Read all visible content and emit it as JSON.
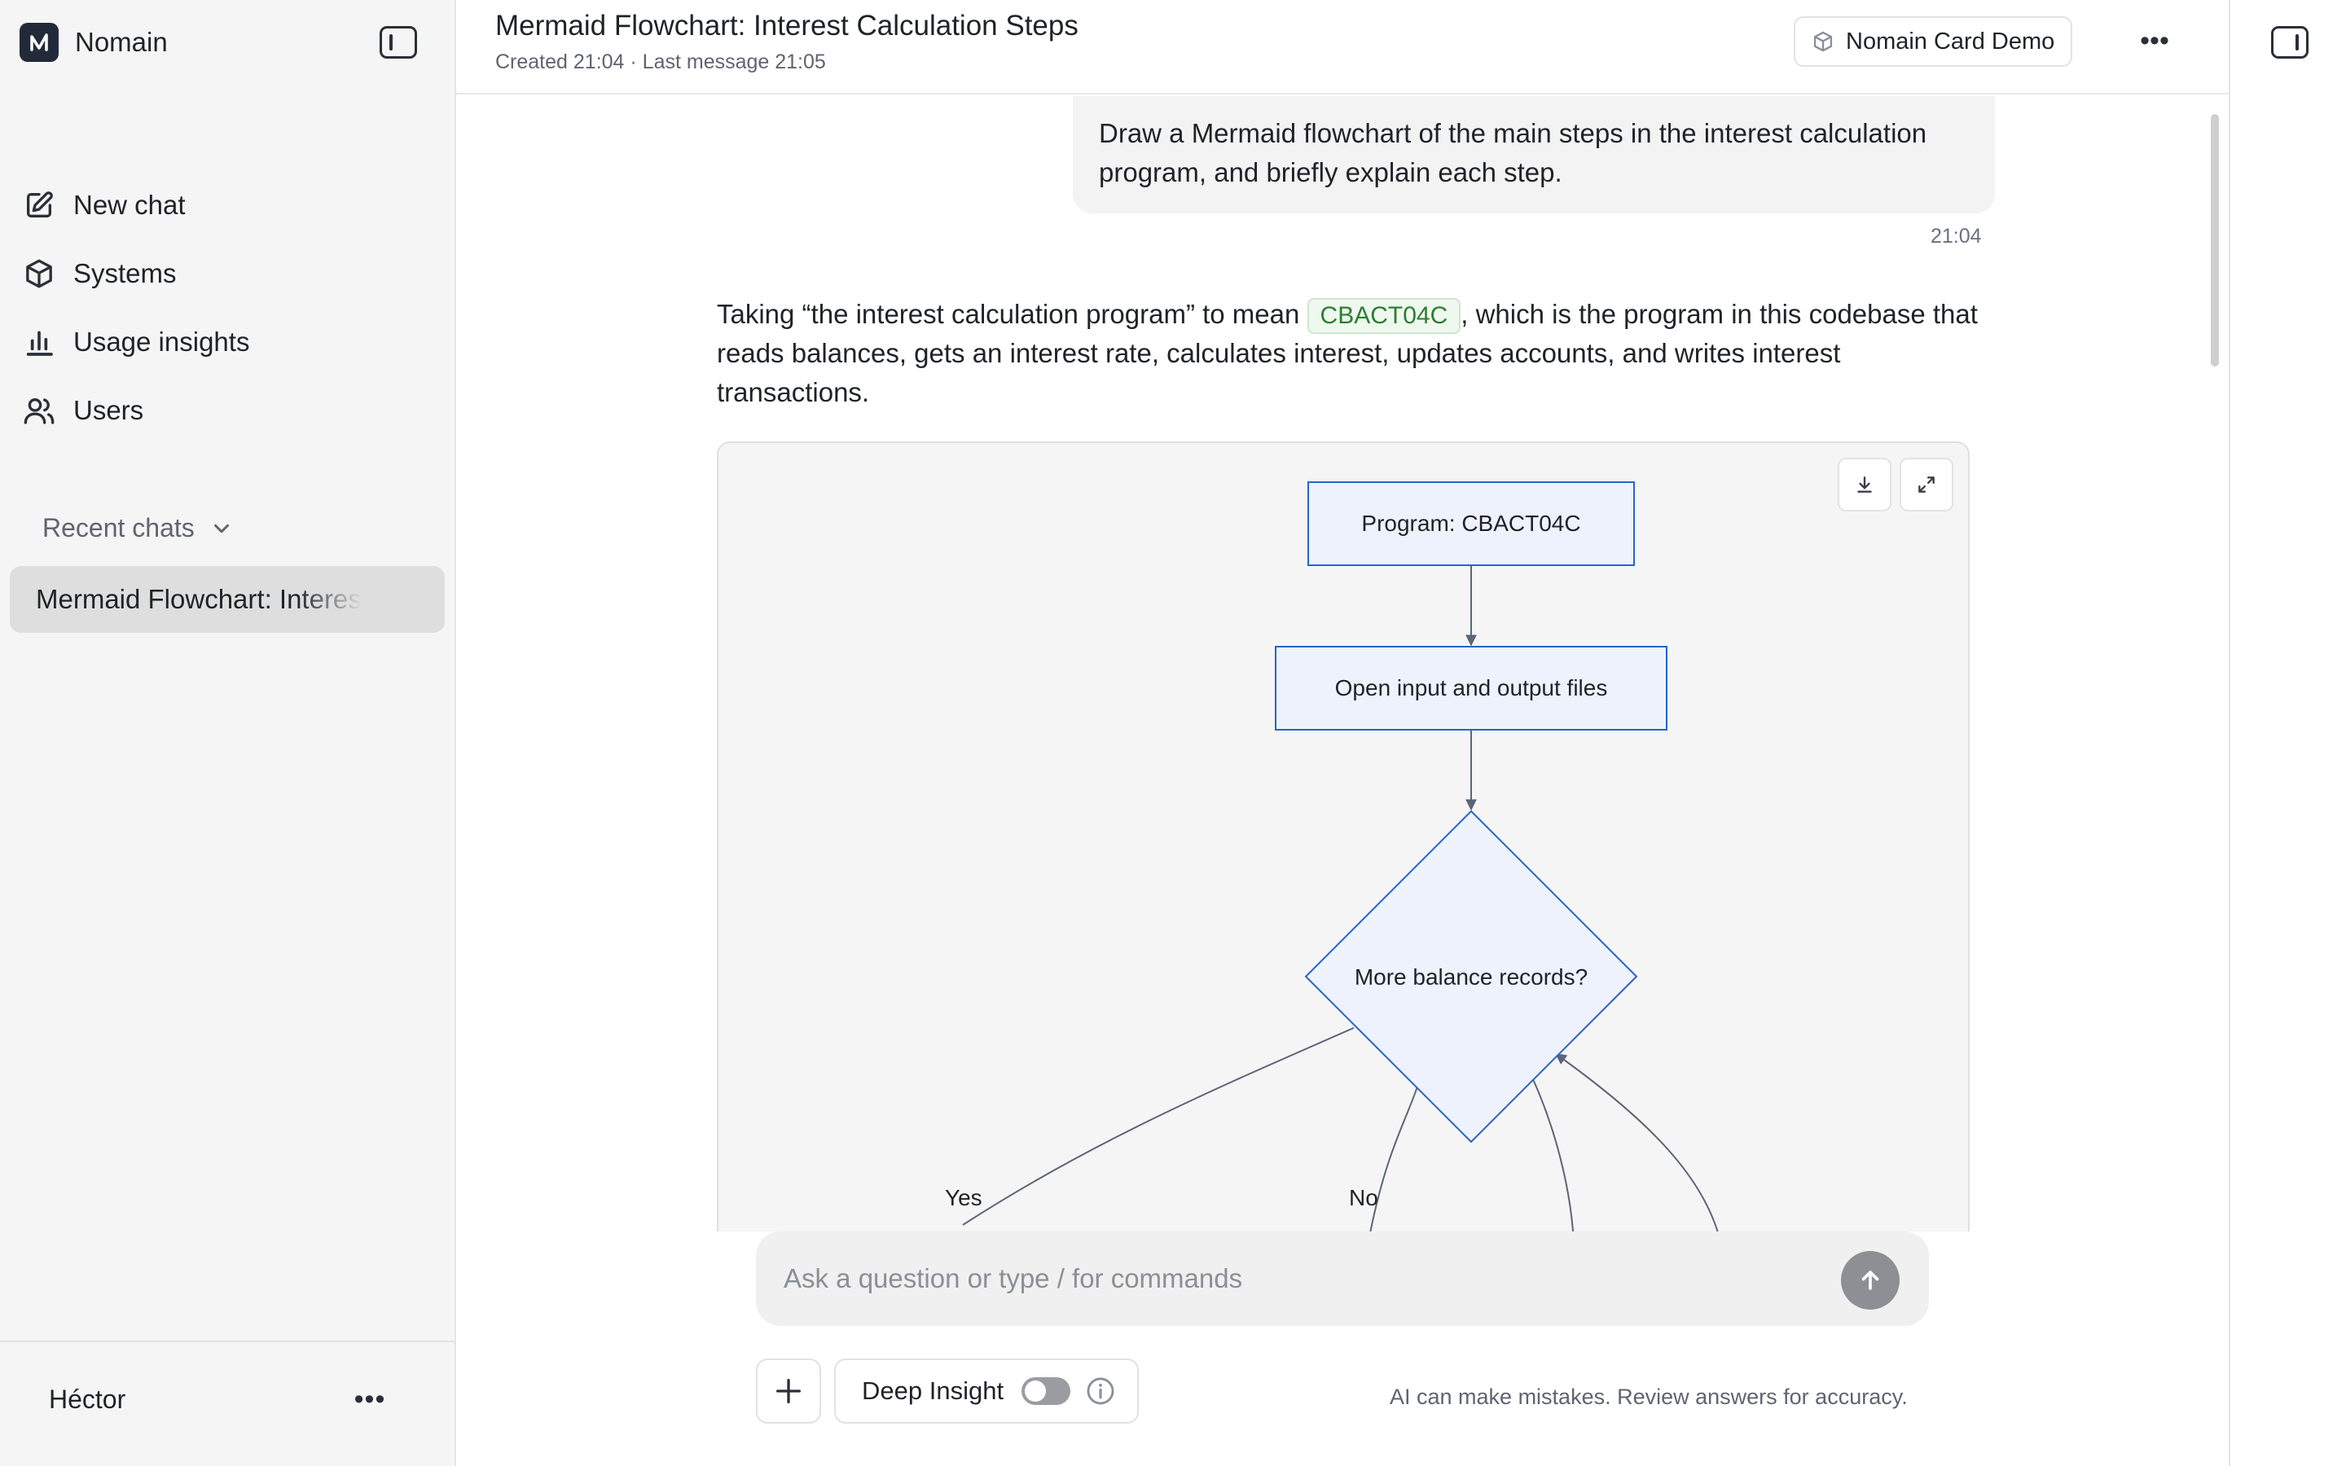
{
  "app": {
    "name": "Nomain"
  },
  "sidebar": {
    "nav": [
      {
        "id": "new-chat",
        "label": "New chat",
        "icon": "edit-icon"
      },
      {
        "id": "systems",
        "label": "Systems",
        "icon": "cube-icon"
      },
      {
        "id": "usage-insights",
        "label": "Usage insights",
        "icon": "bar-chart-icon"
      },
      {
        "id": "users",
        "label": "Users",
        "icon": "users-icon"
      }
    ],
    "recent_label": "Recent chats",
    "recent": [
      {
        "label": "Mermaid Flowchart: Interest Calculation Steps"
      }
    ],
    "user": {
      "name": "Héctor",
      "menu_glyph": "•••"
    }
  },
  "header": {
    "title": "Mermaid Flowchart: Interest Calculation Steps",
    "meta": "Created 21:04 · Last message 21:05",
    "system_chip": "Nomain Card Demo",
    "more_glyph": "•••"
  },
  "messages": {
    "user": {
      "text": "Draw a Mermaid flowchart of the main steps in the interest calculation program, and briefly explain each step.",
      "time": "21:04"
    },
    "assistant": {
      "intro_before": "Taking “the interest calculation program” to mean ",
      "code": "CBACT04C",
      "intro_after": ", which is the program in this codebase that reads balances, gets an interest rate, calculates interest, updates accounts, and writes interest transactions."
    }
  },
  "diagram": {
    "nodes": [
      {
        "id": "program",
        "label": "Program: CBACT04C"
      },
      {
        "id": "open-files",
        "label": "Open input and output files"
      },
      {
        "id": "decision",
        "label": "More balance records?"
      }
    ],
    "edge_labels": {
      "yes": "Yes",
      "no": "No"
    },
    "colors": {
      "node_fill": "#eef2fd",
      "node_stroke": "#2864c8",
      "edge": "#5b6578"
    }
  },
  "composer": {
    "placeholder": "Ask a question or type / for commands",
    "deep_insight_label": "Deep Insight",
    "deep_insight_on": false,
    "disclaimer": "AI can make mistakes. Review answers for accuracy."
  }
}
